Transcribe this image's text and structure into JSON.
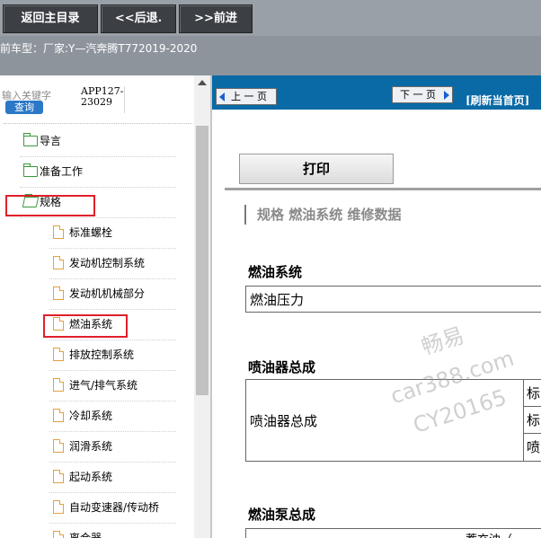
{
  "toolbar": {
    "home_label": "返回主目录",
    "back_label": "<<后退.",
    "forward_label": ">>前进"
  },
  "vehicle": {
    "text": "前车型：厂家:Y—汽奔腾T772019-2020"
  },
  "search": {
    "placeholder": "输入关键字",
    "button": "查询",
    "app_code_line1": "APP127-",
    "app_code_line2": "23029"
  },
  "tree": {
    "items": [
      {
        "label": "导言",
        "type": "folder"
      },
      {
        "label": "准备工作",
        "type": "folder"
      },
      {
        "label": "规格",
        "type": "folder-open"
      },
      {
        "label": "标准螺栓",
        "type": "doc"
      },
      {
        "label": "发动机控制系统",
        "type": "doc"
      },
      {
        "label": "发动机机械部分",
        "type": "doc"
      },
      {
        "label": "燃油系统",
        "type": "doc"
      },
      {
        "label": "排放控制系统",
        "type": "doc"
      },
      {
        "label": "进气/排气系统",
        "type": "doc"
      },
      {
        "label": "冷却系统",
        "type": "doc"
      },
      {
        "label": "润滑系统",
        "type": "doc"
      },
      {
        "label": "起动系统",
        "type": "doc"
      },
      {
        "label": "自动变速器/传动桥",
        "type": "doc"
      },
      {
        "label": "离合器",
        "type": "doc"
      }
    ]
  },
  "nav": {
    "prev": "上 一 页",
    "next": "下 一 页",
    "refresh": "[刷新当首页]"
  },
  "content": {
    "print": "打印",
    "breadcrumb": "规格  燃油系统  维修数据",
    "section1_title": "燃油系统",
    "section1_row": "燃油压力",
    "section2_title": "喷油器总成",
    "section2_row": "喷油器总成",
    "section2_subcells": [
      "标",
      "标",
      "喷"
    ],
    "section3_title": "燃油泵总成",
    "section3_partial": "蓄充油（..."
  },
  "watermark": {
    "line1": "畅易",
    "line2": "car388.com",
    "line3": "CY20165"
  },
  "colors": {
    "toolbar_bg": "#9aa0a8",
    "button_bg": "#3c3f44",
    "nav_blue": "#0a6aa6",
    "highlight_red": "#e0202a"
  }
}
